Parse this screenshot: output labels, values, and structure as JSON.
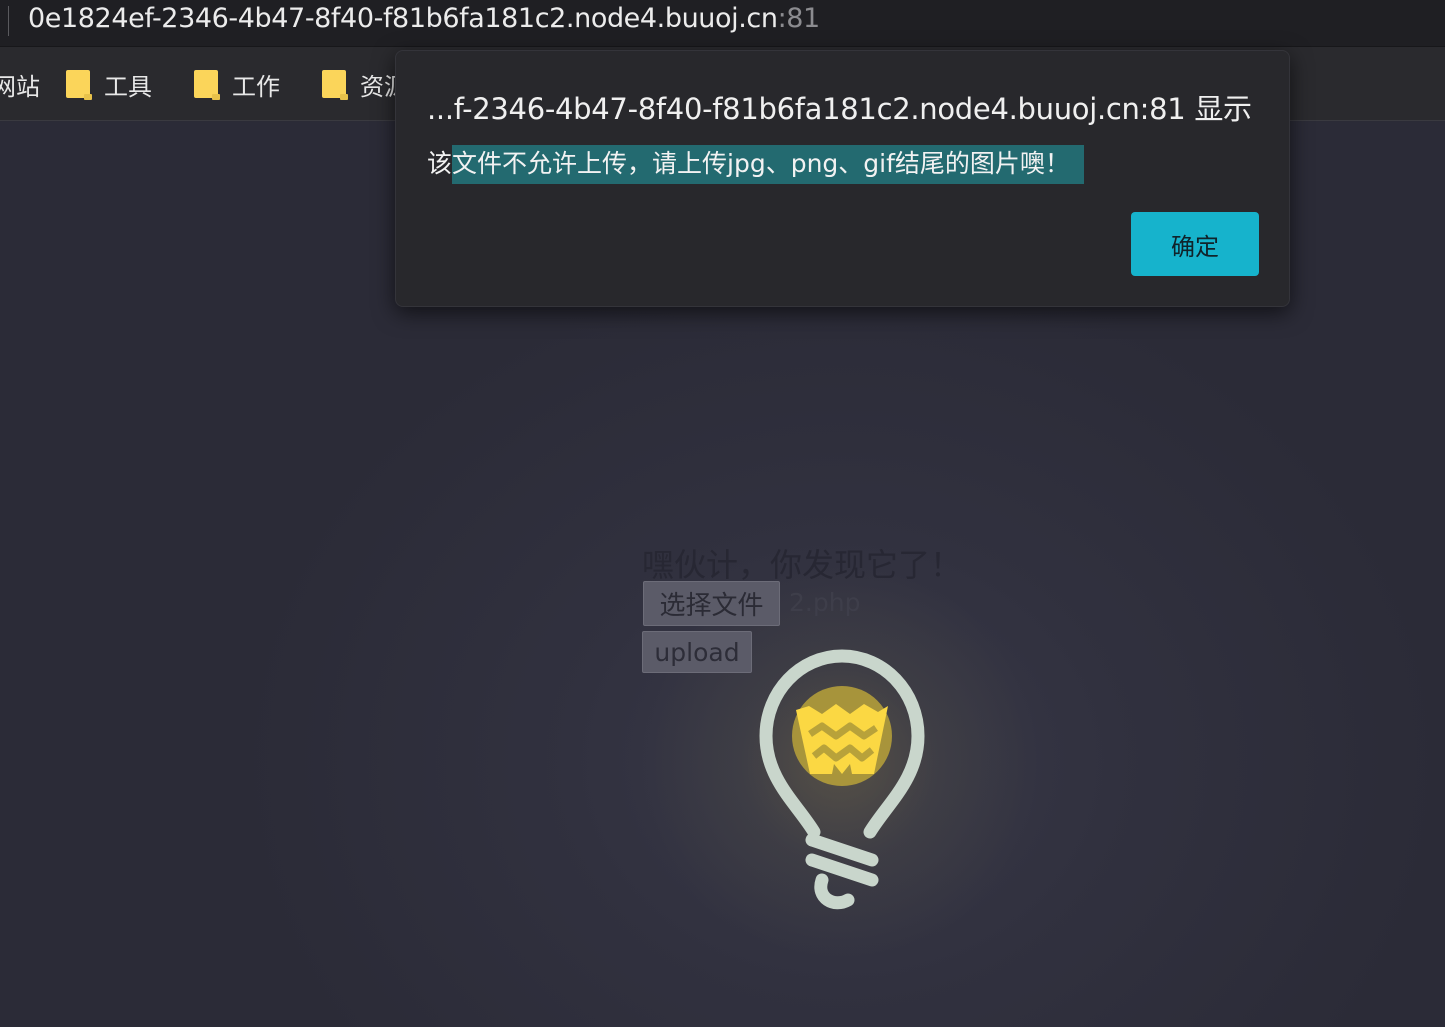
{
  "browser": {
    "url_host": "0e1824ef-2346-4b47-8f40-f81b6fa181c2.node4.buuoj.cn",
    "url_port": ":81",
    "bookmarks": [
      {
        "label": "网站",
        "icon": "folder-icon"
      },
      {
        "label": "工具",
        "icon": "folder-icon"
      },
      {
        "label": "工作",
        "icon": "folder-icon"
      },
      {
        "label": "资源",
        "icon": "folder-icon"
      }
    ]
  },
  "page": {
    "title": "嘿伙计，你发现它了！",
    "choose_file_label": "选择文件",
    "selected_file": "2.php",
    "upload_label": "upload",
    "icon": "lightbulb-icon"
  },
  "dialog": {
    "title": "...f-2346-4b47-8f40-f81b6fa181c2.node4.buuoj.cn:81 显示",
    "message_first_char": "该",
    "message_rest": "文件不允许上传，请上传jpg、png、gif结尾的图片噢！",
    "ok_label": "确定"
  },
  "colors": {
    "accent": "#16b3cc",
    "bulb_yellow": "#fbd843",
    "bulb_outline": "#c9d6cc"
  }
}
